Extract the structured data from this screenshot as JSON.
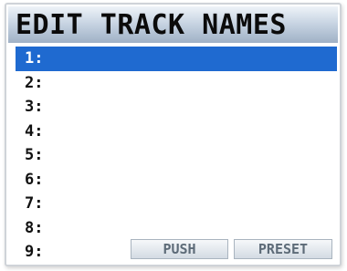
{
  "header": {
    "title": "EDIT TRACK NAMES"
  },
  "tracks": [
    {
      "number": "1:",
      "name": "",
      "selected": true
    },
    {
      "number": "2:",
      "name": "",
      "selected": false
    },
    {
      "number": "3:",
      "name": "",
      "selected": false
    },
    {
      "number": "4:",
      "name": "",
      "selected": false
    },
    {
      "number": "5:",
      "name": "",
      "selected": false
    },
    {
      "number": "6:",
      "name": "",
      "selected": false
    },
    {
      "number": "7:",
      "name": "",
      "selected": false
    },
    {
      "number": "8:",
      "name": "",
      "selected": false
    },
    {
      "number": "9:",
      "name": "",
      "selected": false
    }
  ],
  "buttons": {
    "push_label": "PUSH",
    "preset_label": "PRESET"
  },
  "colors": {
    "selection": "#1f6ad0",
    "title_gradient_top": "#eef3f8",
    "title_gradient_bottom": "#9fb1c6",
    "text": "#111111",
    "button_text": "#5d6b78"
  }
}
